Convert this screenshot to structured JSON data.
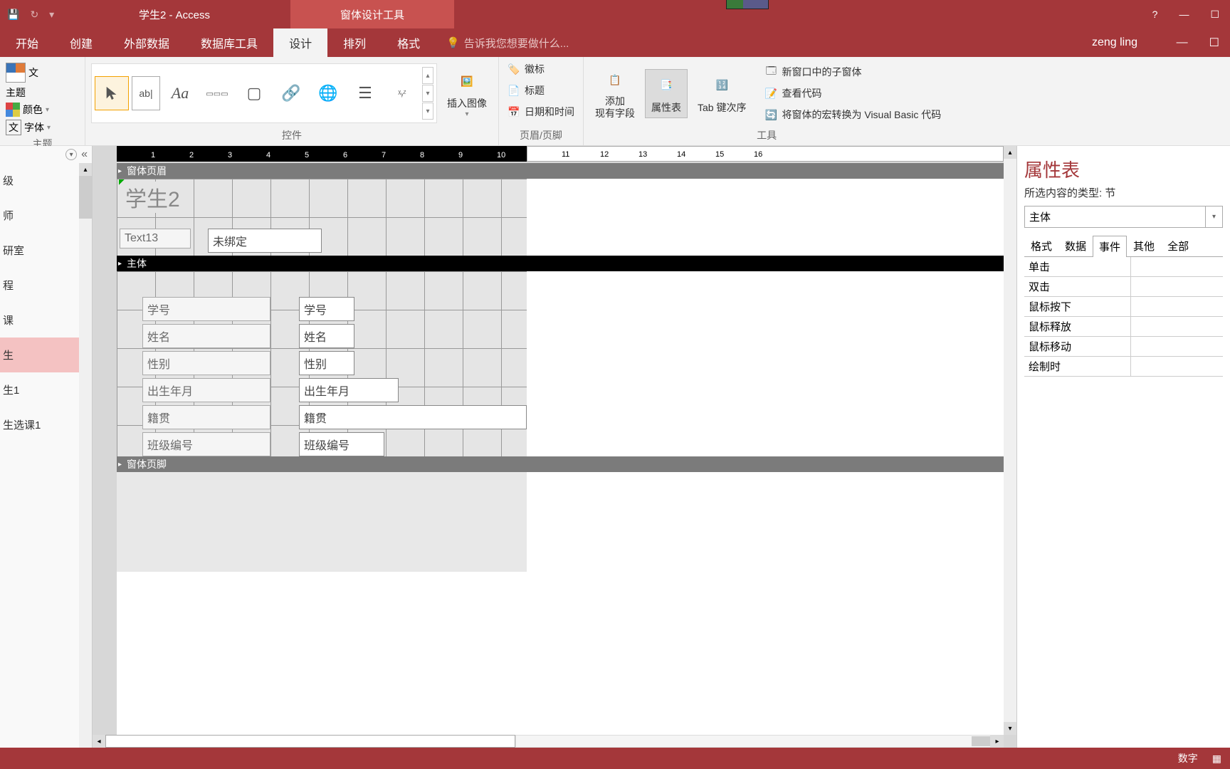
{
  "app_title": "学生2 - Access",
  "contextual_tab_title": "窗体设计工具",
  "user_name": "zeng ling",
  "ribbon_tabs": {
    "start": "开始",
    "create": "创建",
    "external": "外部数据",
    "dbtools": "数据库工具",
    "design": "设计",
    "arrange": "排列",
    "format": "格式"
  },
  "tell_me": "告诉我您想要做什么...",
  "ribbon": {
    "themes_group": "主题",
    "themes_text": "文",
    "themes_main": "主题",
    "colors": "颜色",
    "fonts": "字体",
    "controls_group": "控件",
    "insert_image": "插入图像",
    "header_footer_group": "页眉/页脚",
    "logo": "徽标",
    "title": "标题",
    "date_time": "日期和时间",
    "add_fields": "添加\n现有字段",
    "property_sheet": "属性表",
    "tab_order": "Tab 键次序",
    "subform_new": "新窗口中的子窗体",
    "view_code": "查看代码",
    "convert_macro": "将窗体的宏转换为 Visual Basic 代码",
    "tools_group": "工具"
  },
  "nav": {
    "items": [
      "级",
      "师",
      "研室",
      "程",
      "课",
      "生",
      "生1",
      "生选课1"
    ],
    "selected_index": 5
  },
  "design": {
    "section_header": "窗体页眉",
    "section_detail": "主体",
    "section_footer": "窗体页脚",
    "form_title": "学生2",
    "text_ctrl_name": "Text13",
    "unbound": "未绑定",
    "ruler_h": [
      "1",
      "2",
      "3",
      "4",
      "5",
      "6",
      "7",
      "8",
      "9",
      "10",
      "11",
      "12",
      "13",
      "14",
      "15",
      "16"
    ],
    "fields": [
      {
        "label": "学号",
        "bound": "学号"
      },
      {
        "label": "姓名",
        "bound": "姓名"
      },
      {
        "label": "性别",
        "bound": "性别"
      },
      {
        "label": "出生年月",
        "bound": "出生年月"
      },
      {
        "label": "籍贯",
        "bound": "籍贯"
      },
      {
        "label": "班级编号",
        "bound": "班级编号"
      }
    ]
  },
  "property": {
    "title": "属性表",
    "selection_type": "所选内容的类型: 节",
    "selection_value": "主体",
    "tabs": {
      "format": "格式",
      "data": "数据",
      "event": "事件",
      "other": "其他",
      "all": "全部"
    },
    "rows": [
      "单击",
      "双击",
      "鼠标按下",
      "鼠标释放",
      "鼠标移动",
      "绘制时"
    ]
  },
  "status_bar": {
    "mode": "数字"
  }
}
